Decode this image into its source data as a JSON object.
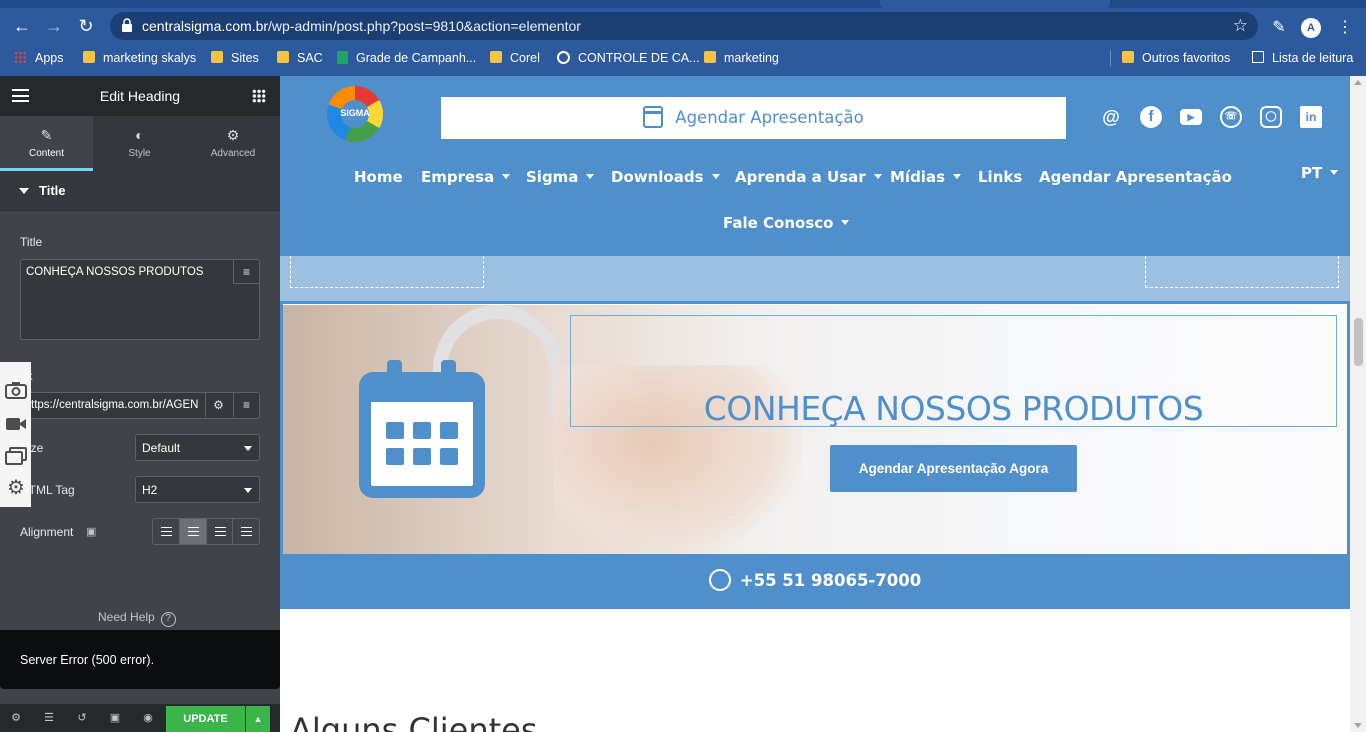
{
  "browser": {
    "url_domain": "centralsigma.com.br",
    "url_path": "/wp-admin/post.php?post=9810&action=elementor",
    "bookmarks": [
      "Apps",
      "marketing skalys",
      "Sites",
      "SAC",
      "Grade de Campanh...",
      "Corel",
      "CONTROLE DE CA...",
      "marketing"
    ],
    "bookmarks_right": [
      "Outros favoritos",
      "Lista de leitura"
    ]
  },
  "panel": {
    "title": "Edit Heading",
    "tabs": [
      "Content",
      "Style",
      "Advanced"
    ],
    "section": "Title",
    "title_label": "Title",
    "title_value": "CONHEÇA NOSSOS PRODUTOS",
    "link_label": "nk",
    "link_value": "ttps://centralsigma.com.br/AGEN",
    "size_label": "Size",
    "size_value": "Default",
    "tag_label": "HTML Tag",
    "tag_value": "H2",
    "alignment_label": "Alignment",
    "need_help": "Need Help",
    "error": "Server Error (500 error).",
    "update": "UPDATE"
  },
  "site": {
    "logo_text": "SIGMA",
    "cta_top": "Agendar Apresentação",
    "menu": [
      "Home",
      "Empresa",
      "Sigma",
      "Downloads",
      "Aprenda a Usar",
      "Mídias",
      "Links",
      "Agendar Apresentação",
      "Fale Conosco"
    ],
    "lang": "PT",
    "hero_title": "CONHEÇA NOSSOS PRODUTOS",
    "hero_button": "Agendar Apresentação Agora",
    "phone": "+55 51 98065-7000",
    "clients_heading": "Alguns Clientes"
  },
  "colors": {
    "brand_blue": "#4f8fcb",
    "chrome_blue": "#2d5a9e",
    "panel_dark": "#404349",
    "update_green": "#39b54a"
  }
}
